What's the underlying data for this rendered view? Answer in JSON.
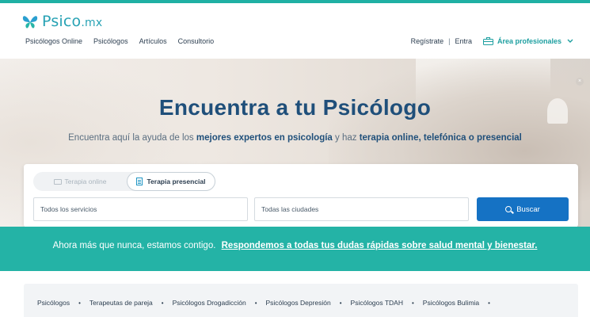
{
  "brand": {
    "name": "Psico",
    "tld": ".mx",
    "logo_icon": "butterfly-icon",
    "accent_color": "#1fb0a4",
    "primary_color": "#1572c4",
    "heading_color": "#1f4f7a"
  },
  "nav": {
    "left_items": [
      "Psicólogos Online",
      "Psicólogos",
      "Artículos",
      "Consultorio"
    ],
    "register": "Regístrate",
    "separator": "|",
    "login": "Entra",
    "pro_area": "Área profesionales",
    "pro_icon": "briefcase-icon",
    "pro_chevron_icon": "chevron-down-icon"
  },
  "hero": {
    "title": "Encuentra a tu Psicólogo",
    "subtitle_pre": "Encuentra aquí la ayuda de los ",
    "subtitle_bold1": "mejores expertos en psicología",
    "subtitle_mid": " y haz ",
    "subtitle_bold2": "terapia online, telefónica o presencial"
  },
  "search": {
    "tab_online": "Terapia online",
    "tab_online_icon": "video-camera-icon",
    "tab_presencial": "Terapia presencial",
    "tab_presencial_icon": "building-icon",
    "active_tab": "Terapia presencial",
    "services_value": "Todos los servicios",
    "cities_value": "Todas las ciudades",
    "button_label": "Buscar",
    "button_icon": "search-icon"
  },
  "banner": {
    "text": "Ahora más que nunca, estamos contigo.",
    "link": "Respondemos a todas tus dudas rápidas sobre salud mental y bienestar."
  },
  "categories": {
    "items": [
      "Psicólogos",
      "Terapeutas de pareja",
      "Psicólogos Drogadicción",
      "Psicólogos Depresión",
      "Psicólogos TDAH",
      "Psicólogos Bulimia"
    ],
    "bullet": "•"
  }
}
